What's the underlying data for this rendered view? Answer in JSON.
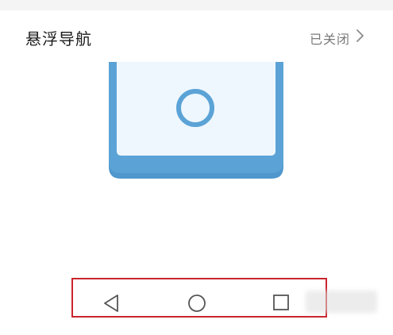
{
  "setting": {
    "title": "悬浮导航",
    "status": "已关闭"
  },
  "icons": {
    "chevron": "chevron-right-icon",
    "back": "back-triangle-icon",
    "home": "home-circle-icon",
    "recent": "recent-apps-square-icon"
  },
  "colors": {
    "illustration_blue": "#5ba3d6",
    "illustration_screen": "#eef7fd",
    "highlight_red": "#c9252d",
    "nav_icon": "#555555"
  }
}
